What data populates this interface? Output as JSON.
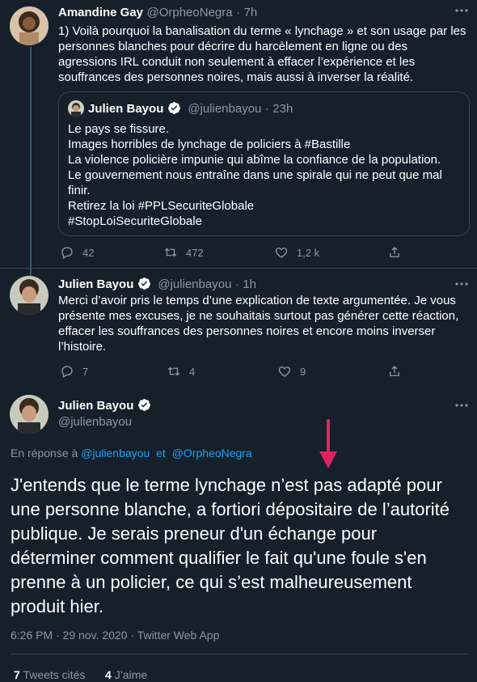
{
  "tweet1": {
    "name": "Amandine Gay",
    "handle": "@OrpheoNegra",
    "sep": "·",
    "time": "7h",
    "text": "1) Voilà pourquoi la banalisation du terme « lynchage » et son usage par les personnes blanches pour décrire du harcèlement en ligne ou des agressions IRL conduit non seulement à effacer l’expérience et les souffrances des personnes noires, mais aussi à inverser la réalité.",
    "quote": {
      "name": "Julien Bayou",
      "handle": "@julienbayou",
      "sep": "·",
      "time": "23h",
      "lines": [
        "Le pays se fissure.",
        "Images horribles de lynchage de policiers à #Bastille",
        "La violence policière impunie qui abîme la confiance de la population.",
        "Le gouvernement nous entraîne dans une spirale qui ne peut que mal finir.",
        "Retirez la loi #PPLSecuriteGlobale",
        "#StopLoiSecuriteGlobale"
      ]
    },
    "replies": "42",
    "retweets": "472",
    "likes": "1,2 k"
  },
  "tweet2": {
    "name": "Julien Bayou",
    "handle": "@julienbayou",
    "sep": "·",
    "time": "1h",
    "text": "Merci d’avoir pris le temps d’une explication de texte argumentée. Je vous présente mes excuses, je ne souhaitais surtout pas générer cette réaction, effacer les souffrances des personnes noires et encore moins inverser l’histoire.",
    "replies": "7",
    "retweets": "4",
    "likes": "9"
  },
  "main": {
    "name": "Julien Bayou",
    "handle": "@julienbayou",
    "reply_prefix": "En réponse à",
    "reply_to_1": "@julienbayou",
    "reply_and": "et",
    "reply_to_2": "@OrpheoNegra",
    "text": "J'entends que le terme lynchage n’est pas adapté pour une personne blanche, a fortiori dépositaire de l’autorité publique. Je serais preneur d'un échange pour déterminer comment qualifier le fait qu'une foule s'en prenne à un policier, ce qui s’est malheureusement produit hier.",
    "timestamp": "6:26 PM · 29 nov. 2020 · Twitter Web App",
    "quote_tweets_count": "7",
    "quote_tweets_label": "Tweets cités",
    "likes_count": "4",
    "likes_label": "J’aime"
  },
  "colors": {
    "background": "#15202b",
    "accent": "#1da1f2",
    "muted": "#8899a6",
    "arrow": "#e0245e"
  }
}
